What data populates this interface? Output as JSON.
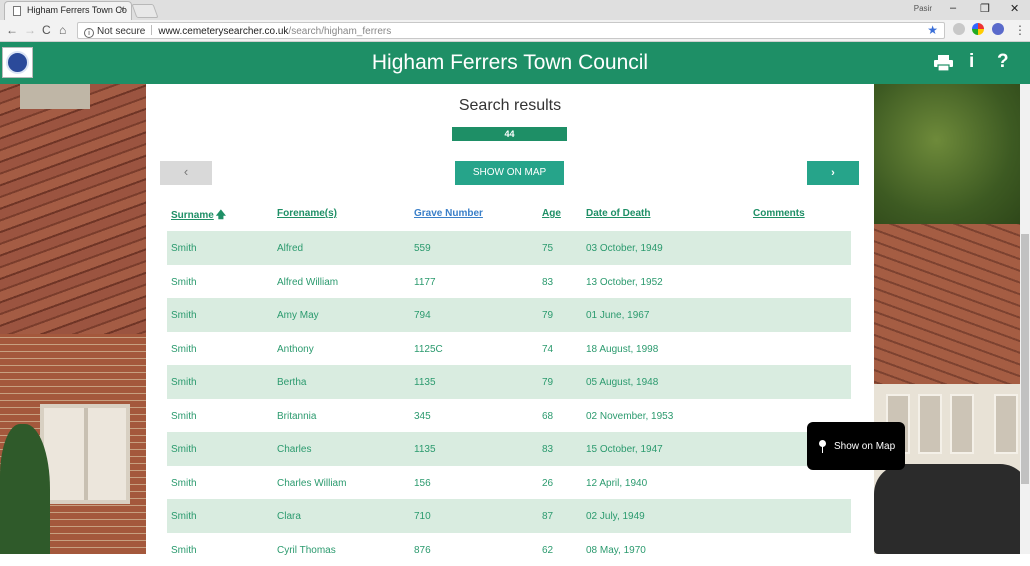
{
  "browser": {
    "tab_title": "Higham Ferrers Town Co",
    "tab_close": "×",
    "profile_name": "Pasir",
    "url_security": "Not secure",
    "url_host": "www.cemeterysearcher.co.uk",
    "url_path": "/search/higham_ferrers",
    "back": "←",
    "forward": "→",
    "reload": "C",
    "home": "⌂",
    "min": "–",
    "restore": "❐",
    "close": "✕",
    "menu": "⋮",
    "star": "★"
  },
  "header": {
    "title": "Higham Ferrers Town Council",
    "info_icon": "i",
    "help_icon": "?"
  },
  "results": {
    "heading": "Search results",
    "count": "44",
    "prev_label": "‹",
    "map_label": "SHOW ON MAP",
    "next_label": "›",
    "float_map_label": "Show on Map"
  },
  "table": {
    "sort_arrow": "🡅",
    "columns": {
      "surname": "Surname",
      "forenames": "Forename(s)",
      "grave": "Grave Number",
      "age": "Age",
      "dod": "Date of Death",
      "comments": "Comments"
    },
    "rows": [
      {
        "surname": "Smith",
        "forenames": "Alfred",
        "grave": "559",
        "age": "75",
        "dod": "03 October, 1949",
        "comments": ""
      },
      {
        "surname": "Smith",
        "forenames": "Alfred William",
        "grave": "1177",
        "age": "83",
        "dod": "13 October, 1952",
        "comments": ""
      },
      {
        "surname": "Smith",
        "forenames": "Amy May",
        "grave": "794",
        "age": "79",
        "dod": "01 June, 1967",
        "comments": ""
      },
      {
        "surname": "Smith",
        "forenames": "Anthony",
        "grave": "1125C",
        "age": "74",
        "dod": "18 August, 1998",
        "comments": ""
      },
      {
        "surname": "Smith",
        "forenames": "Bertha",
        "grave": "1135",
        "age": "79",
        "dod": "05 August, 1948",
        "comments": ""
      },
      {
        "surname": "Smith",
        "forenames": "Britannia",
        "grave": "345",
        "age": "68",
        "dod": "02 November, 1953",
        "comments": ""
      },
      {
        "surname": "Smith",
        "forenames": "Charles",
        "grave": "1135",
        "age": "83",
        "dod": "15 October, 1947",
        "comments": ""
      },
      {
        "surname": "Smith",
        "forenames": "Charles William",
        "grave": "156",
        "age": "26",
        "dod": "12 April, 1940",
        "comments": ""
      },
      {
        "surname": "Smith",
        "forenames": "Clara",
        "grave": "710",
        "age": "87",
        "dod": "02 July, 1949",
        "comments": ""
      },
      {
        "surname": "Smith",
        "forenames": "Cyril Thomas",
        "grave": "876",
        "age": "62",
        "dod": "08 May, 1970",
        "comments": ""
      }
    ]
  },
  "colors": {
    "brand": "#1e8f66",
    "button": "#26a48a",
    "row_alt": "#d9ece0",
    "link_blue": "#3a7fc8"
  }
}
